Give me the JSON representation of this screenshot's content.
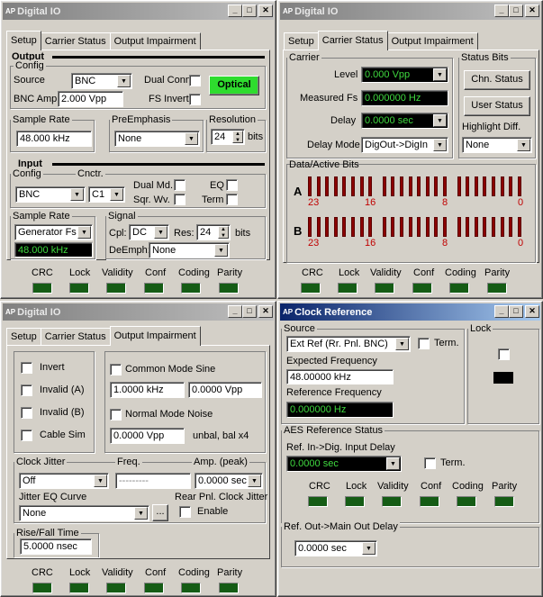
{
  "w1": {
    "title": "Digital IO",
    "tabs": [
      "Setup",
      "Carrier Status",
      "Output Impairment"
    ],
    "output": "Output",
    "config": "Config",
    "source_lbl": "Source",
    "source_val": "BNC",
    "dual_conn": "Dual Conn.",
    "optical": "Optical",
    "bnc_amp": "BNC Amp",
    "bnc_amp_val": "2.000 Vpp",
    "fs_invert": "FS Invert",
    "sample_rate": "Sample Rate",
    "sample_rate_val": "48.000 kHz",
    "preemph": "PreEmphasis",
    "preemph_val": "None",
    "resolution": "Resolution",
    "res_val": "24",
    "bits": "bits",
    "input": "Input",
    "in_config": "Config",
    "cnctr": "Cnctr.",
    "in_config_val": "BNC",
    "cnctr_val": "C1",
    "dual_md": "Dual Md.",
    "eq": "EQ",
    "sqr_wv": "Sqr. Wv.",
    "term": "Term",
    "in_sample_rate": "Sample Rate",
    "in_sr_val": "Generator Fs",
    "in_sr_readout": "48.000 kHz",
    "signal": "Signal",
    "cpl": "Cpl:",
    "cpl_val": "DC",
    "res": "Res:",
    "res2_val": "24",
    "bits2": "bits",
    "deemph": "DeEmph:",
    "deemph_val": "None"
  },
  "status_labels": [
    "CRC",
    "Lock",
    "Validity",
    "Conf",
    "Coding",
    "Parity"
  ],
  "w2": {
    "title": "Digital IO",
    "tabs": [
      "Setup",
      "Carrier Status",
      "Output Impairment"
    ],
    "carrier": "Carrier",
    "level": "Level",
    "level_val": "0.000 Vpp",
    "measured_fs": "Measured Fs",
    "measured_fs_val": "0.000000 Hz",
    "delay": "Delay",
    "delay_val": "0.0000 sec",
    "delay_mode": "Delay Mode",
    "delay_mode_val": "DigOut->DigIn",
    "status_bits": "Status Bits",
    "chn_status": "Chn. Status",
    "user_status": "User Status",
    "highlight": "Highlight Diff.",
    "highlight_val": "None",
    "data_bits": "Data/Active Bits",
    "a": "A",
    "b": "B",
    "ticks": [
      "23",
      "16",
      "8",
      "0"
    ]
  },
  "w3": {
    "title": "Digital IO",
    "tabs": [
      "Setup",
      "Carrier Status",
      "Output Impairment"
    ],
    "invert": "Invert",
    "invalid_a": "Invalid (A)",
    "invalid_b": "Invalid (B)",
    "cable_sim": "Cable Sim",
    "cms": "Common Mode Sine",
    "cms_f": "1.0000 kHz",
    "cms_a": "0.0000 Vpp",
    "nmn": "Normal Mode Noise",
    "nmn_a": "0.0000 Vpp",
    "unbal": "unbal, bal x4",
    "clock_jitter": "Clock Jitter",
    "cj_val": "Off",
    "freq": "Freq.",
    "freq_val": "---------",
    "amp": "Amp. (peak)",
    "amp_val": "0.0000 sec",
    "jitter_eq": "Jitter EQ Curve",
    "jeq_val": "None",
    "ellipsis": "...",
    "rear": "Rear Pnl. Clock Jitter",
    "enable": "Enable",
    "rise_fall": "Rise/Fall Time",
    "rf_val": "5.0000 nsec"
  },
  "w4": {
    "title": "Clock Reference",
    "source": "Source",
    "source_val": "Ext Ref (Rr. Pnl. BNC)",
    "term": "Term.",
    "lock": "Lock",
    "expected": "Expected Frequency",
    "expected_val": "48.00000 kHz",
    "reference": "Reference Frequency",
    "reference_val": "0.000000 Hz",
    "aes": "AES Reference Status",
    "ref_in": "Ref. In->Dig. Input Delay",
    "ref_in_val": "0.0000 sec",
    "term2": "Term.",
    "ref_out": "Ref. Out->Main Out Delay",
    "ref_out_val": "0.0000 sec"
  }
}
